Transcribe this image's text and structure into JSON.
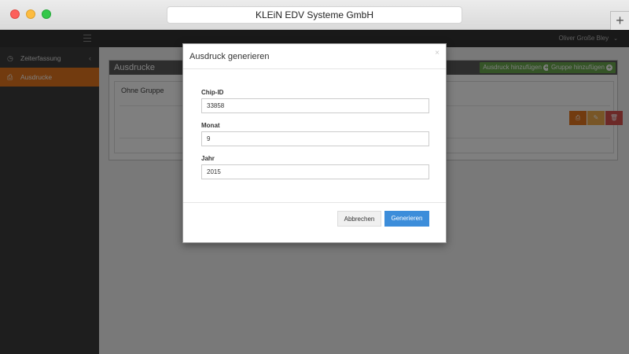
{
  "window": {
    "title": "KLEiN EDV Systeme GmbH"
  },
  "topnav": {
    "user": "Oliver Große Bley"
  },
  "sidebar": {
    "items": [
      {
        "label": "Zeiterfassung",
        "icon": "clock-icon"
      },
      {
        "label": "Ausdrucke",
        "icon": "printer-icon"
      }
    ]
  },
  "page": {
    "title": "Ausdrucke",
    "add_print_label": "Ausdruck hinzufügen",
    "add_group_label": "Gruppe hinzufügen",
    "group_title": "Ohne Gruppe"
  },
  "modal": {
    "title": "Ausdruck generieren",
    "close_label": "×",
    "fields": [
      {
        "label": "Chip-ID",
        "value": "33858"
      },
      {
        "label": "Monat",
        "value": "9"
      },
      {
        "label": "Jahr",
        "value": "2015"
      }
    ],
    "cancel_label": "Abbrechen",
    "submit_label": "Generieren"
  },
  "colors": {
    "accent": "#e4771e",
    "primary": "#3c8dda",
    "success": "#6aa84f",
    "danger": "#d9534f",
    "warning": "#f0ad4e"
  }
}
